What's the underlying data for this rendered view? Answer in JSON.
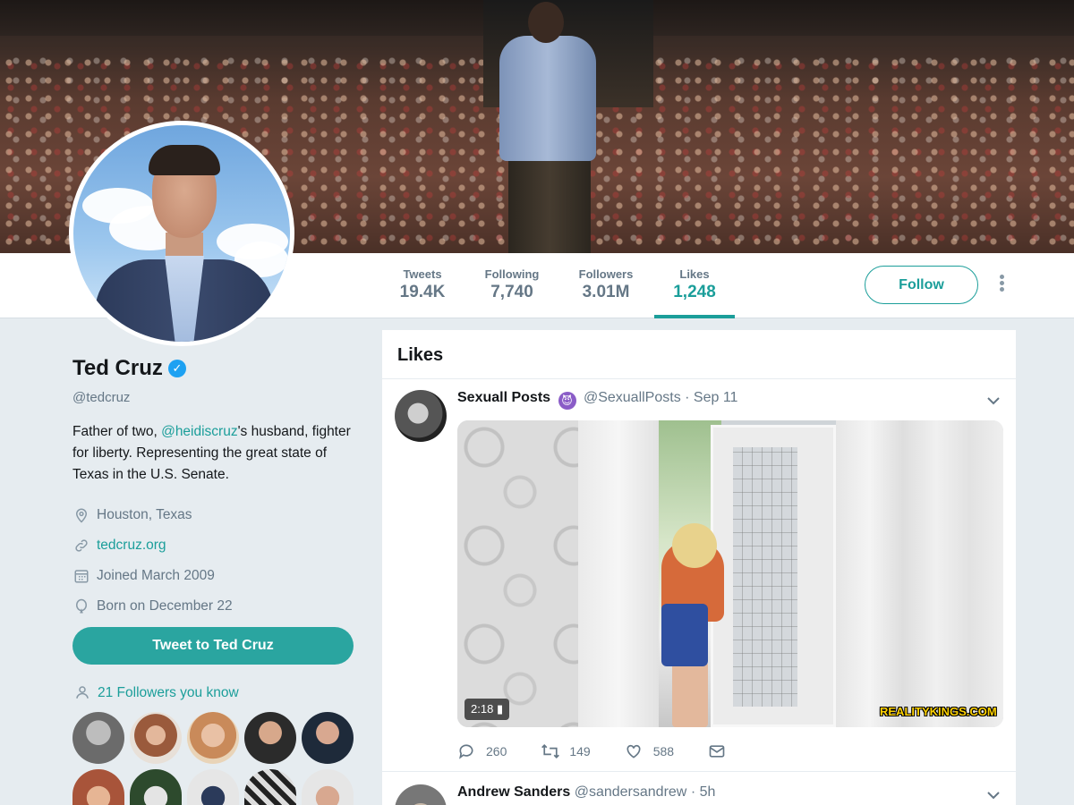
{
  "profile": {
    "name": "Ted Cruz",
    "handle": "@tedcruz",
    "bio_prefix": "Father of two, ",
    "bio_mention": "@heidiscruz",
    "bio_suffix": "'s husband, fighter for liberty. Representing the great state of Texas in the U.S. Senate.",
    "location": "Houston, Texas",
    "website": "tedcruz.org",
    "joined": "Joined March 2009",
    "born": "Born on December 22",
    "tweet_to_label": "Tweet to Ted Cruz",
    "followers_you_know": "21 Followers you know"
  },
  "stats": [
    {
      "label": "Tweets",
      "value": "19.4K"
    },
    {
      "label": "Following",
      "value": "7,740"
    },
    {
      "label": "Followers",
      "value": "3.01M"
    },
    {
      "label": "Likes",
      "value": "1,248"
    }
  ],
  "active_tab": "Likes",
  "actions": {
    "follow_label": "Follow"
  },
  "timeline": {
    "title": "Likes",
    "tweets": [
      {
        "name": "Sexuall Posts",
        "handle": "@SexuallPosts",
        "time": "· Sep 11",
        "video_duration": "2:18",
        "watermark": "REALITYKINGS.COM",
        "replies": "260",
        "retweets": "149",
        "likes": "588"
      },
      {
        "name": "Andrew Sanders",
        "handle": "@sandersandrew",
        "time": "· 5h"
      }
    ]
  },
  "colors": {
    "accent": "#1b9e9a",
    "tweet_button": "#2aa5a0",
    "verified": "#1da1f2",
    "page_bg": "#e6ecf0"
  },
  "icons": [
    "verified-badge-icon",
    "location-pin-icon",
    "link-icon",
    "calendar-icon",
    "balloon-icon",
    "person-icon",
    "chevron-down-icon",
    "reply-icon",
    "retweet-icon",
    "heart-icon",
    "message-icon",
    "more-vertical-icon"
  ]
}
